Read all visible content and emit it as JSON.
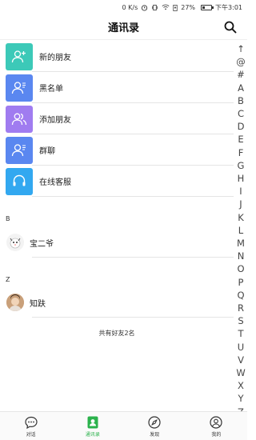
{
  "status_bar": {
    "speed": "0 K/s",
    "battery_percent": "27%",
    "battery_level": 0.27,
    "time": "下午3:01"
  },
  "header": {
    "title": "通讯录",
    "search_icon": "search-icon"
  },
  "functions": [
    {
      "label": "新的朋友",
      "icon": "add-friend-icon",
      "color": "#3cc9b8"
    },
    {
      "label": "黑名单",
      "icon": "blacklist-icon",
      "color": "#5a87f0"
    },
    {
      "label": "添加朋友",
      "icon": "add-friend-group-icon",
      "color": "#a07cf0"
    },
    {
      "label": "群聊",
      "icon": "group-chat-icon",
      "color": "#5a87f0"
    },
    {
      "label": "在线客服",
      "icon": "headset-icon",
      "color": "#32a8f0"
    }
  ],
  "sections": [
    {
      "letter": "B",
      "contacts": [
        {
          "name": "宝二爷"
        }
      ]
    },
    {
      "letter": "Z",
      "contacts": [
        {
          "name": "知趺"
        }
      ]
    }
  ],
  "friend_count_text": "共有好友2名",
  "index_letters": [
    "↑",
    "@",
    "#",
    "A",
    "B",
    "C",
    "D",
    "E",
    "F",
    "G",
    "H",
    "I",
    "J",
    "K",
    "L",
    "M",
    "N",
    "O",
    "P",
    "Q",
    "R",
    "S",
    "T",
    "U",
    "V",
    "W",
    "X",
    "Y",
    "Z"
  ],
  "tabs": [
    {
      "label": "对话",
      "icon": "chat-bubble-icon",
      "active": false
    },
    {
      "label": "通讯录",
      "icon": "contacts-icon",
      "active": true
    },
    {
      "label": "发现",
      "icon": "compass-icon",
      "active": false
    },
    {
      "label": "我的",
      "icon": "profile-icon",
      "active": false
    }
  ],
  "accent_color": "#2bb24c"
}
